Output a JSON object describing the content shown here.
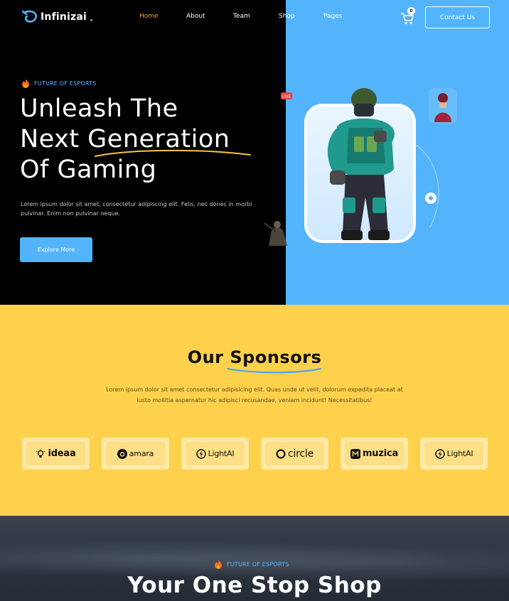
{
  "brand": {
    "name": "Infinizai"
  },
  "nav": {
    "items": [
      {
        "label": "Home",
        "active": true
      },
      {
        "label": "About",
        "active": false
      },
      {
        "label": "Team",
        "active": false
      },
      {
        "label": "Shop",
        "active": false
      },
      {
        "label": "Pages",
        "active": false
      }
    ],
    "cart_count": "0",
    "contact_label": "Contact Us"
  },
  "hero": {
    "eyebrow": "FUTURE OF ESPORTS",
    "title_lines": [
      "Unleash The",
      "Next Generation",
      "Of Gaming"
    ],
    "description": "Lorem ipsum dolor sit amet, consectetur adipiscing elit. Felis, nec donec in morbi pulvinar. Enim non pulvinar neque.",
    "cta_label": "Explore More",
    "live_label": "LIVE"
  },
  "sponsors": {
    "title": "Our Sponsors",
    "description": "Lorem ipsum dolor sit amet consectetur adipisicing elit. Quas unde ut velit, dolorum expedita placeat at iusto mollitia aspernatur hic adipisci recusandae, veniam incidunt! Necessitatibus!",
    "logos": [
      {
        "name": "ideaa",
        "icon": "lightbulb-icon"
      },
      {
        "name": "amara",
        "icon": "a-circle-icon"
      },
      {
        "name": "LightAI",
        "icon": "bolt-circle-icon"
      },
      {
        "name": "circle",
        "icon": "ring-icon"
      },
      {
        "name": "muzica",
        "icon": "m-square-icon"
      },
      {
        "name": "LightAI",
        "icon": "bolt-circle-icon"
      }
    ]
  },
  "shop": {
    "eyebrow": "FUTURE OF ESPORTS",
    "title": "Your One Stop Shop"
  },
  "colors": {
    "accent_blue": "#53b4fb",
    "nav_active": "#f5a623",
    "sponsor_bg": "#fdd14c",
    "hero_bg": "#000000"
  }
}
